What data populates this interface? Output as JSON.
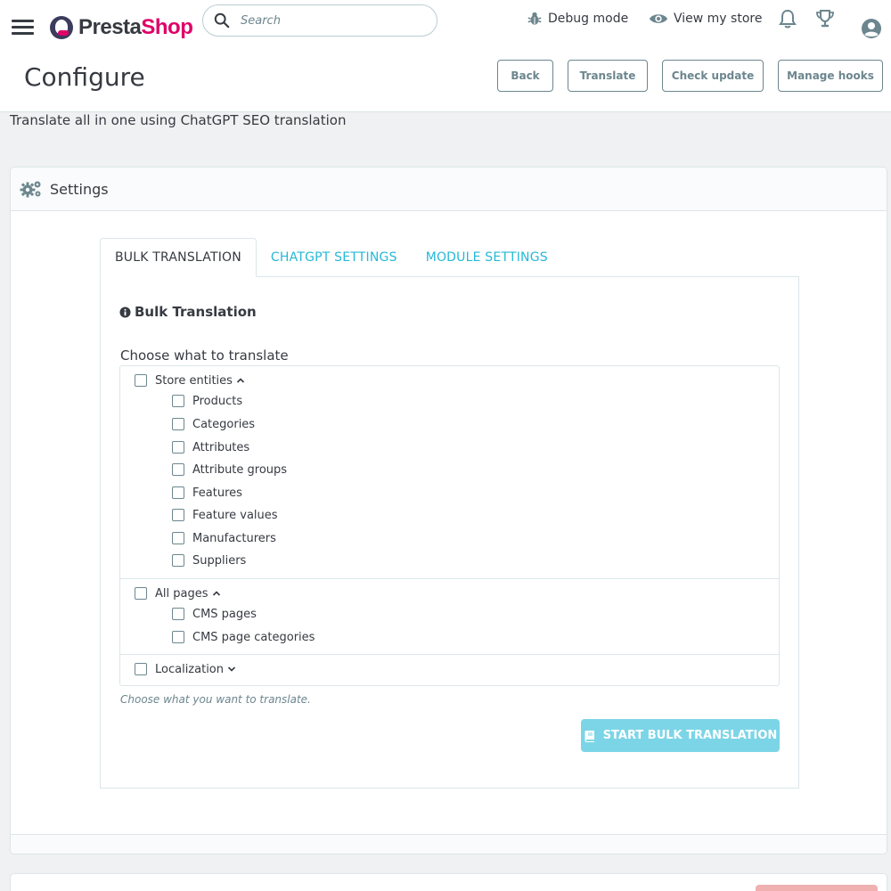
{
  "header": {
    "logo_part1": "Presta",
    "logo_part2": "Shop",
    "search_placeholder": "Search",
    "debug_mode": "Debug mode",
    "view_store": "View my store"
  },
  "page": {
    "title": "Configure",
    "buttons": {
      "back": "Back",
      "translate": "Translate",
      "check_update": "Check update",
      "manage_hooks": "Manage hooks"
    },
    "subtitle": "Translate all in one using ChatGPT SEO translation"
  },
  "panel": {
    "title": "Settings",
    "tabs": [
      {
        "label": "BULK TRANSLATION",
        "active": true
      },
      {
        "label": "CHATGPT SETTINGS",
        "active": false
      },
      {
        "label": "MODULE SETTINGS",
        "active": false
      }
    ],
    "section_title": "Bulk Translation",
    "choose_label": "Choose what to translate",
    "groups": [
      {
        "label": "Store entities",
        "expanded": true,
        "children": [
          "Products",
          "Categories",
          "Attributes",
          "Attribute groups",
          "Features",
          "Feature values",
          "Manufacturers",
          "Suppliers"
        ]
      },
      {
        "label": "All pages",
        "expanded": true,
        "children": [
          "CMS pages",
          "CMS page categories"
        ]
      },
      {
        "label": "Localization",
        "expanded": false,
        "children": []
      }
    ],
    "help_text": "Choose what you want to translate.",
    "start_button": "START BULK TRANSLATION"
  },
  "colors": {
    "accent": "#25b9d7",
    "brand": "#df0067",
    "primary_disabled": "#7cd5e7",
    "text": "#363a41",
    "muted": "#6c868e"
  }
}
